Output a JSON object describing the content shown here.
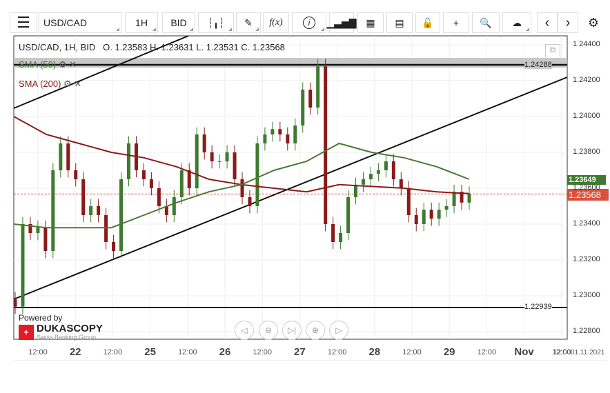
{
  "toolbar": {
    "instrument": "USD/CAD",
    "period": "1H",
    "side": "BID",
    "menu_icon": "hamburger-icon",
    "tools": [
      "candles-icon",
      "pencil-icon",
      "function-icon",
      "info-icon",
      "volume-bars-icon",
      "calendar-icon",
      "calculator-icon",
      "lock-icon",
      "crosshair-icon",
      "zoom-search-icon",
      "cloud-upload-icon",
      "chevron-left-icon",
      "chevron-right-icon",
      "gear-icon"
    ]
  },
  "header": {
    "title": "USD/CAD, 1H, BID",
    "ohlc": "O. 1.23583 H. 1.23631 L. 1.23531 C. 1.23568"
  },
  "indicators": [
    {
      "label": "SMA (50)",
      "color": "#4a7a33"
    },
    {
      "label": "SMA (200)",
      "color": "#8b1a1a"
    }
  ],
  "levels": {
    "upper": "1.24288",
    "lower": "1.22939"
  },
  "price_tags": {
    "sma50": "1.23649",
    "last": "1.23568"
  },
  "branding": {
    "powered": "Powered by",
    "logo": "DUKASCOPY",
    "tagline": "Swiss Banking Group"
  },
  "y_ticks": [
    "1.24400",
    "1.24200",
    "1.24000",
    "1.23800",
    "1.23600",
    "1.23400",
    "1.23200",
    "1.23000",
    "1.22800"
  ],
  "x_ticks": [
    {
      "t": "12:00",
      "day": false
    },
    {
      "t": "22",
      "day": true
    },
    {
      "t": "12:00",
      "day": false
    },
    {
      "t": "25",
      "day": true
    },
    {
      "t": "12:00",
      "day": false
    },
    {
      "t": "26",
      "day": true
    },
    {
      "t": "12:00",
      "day": false
    },
    {
      "t": "27",
      "day": true
    },
    {
      "t": "12:00",
      "day": false
    },
    {
      "t": "28",
      "day": true
    },
    {
      "t": "12:00",
      "day": false
    },
    {
      "t": "29",
      "day": true
    },
    {
      "t": "12:00",
      "day": false
    },
    {
      "t": "Nov",
      "day": true
    },
    {
      "t": "12:00",
      "day": false
    }
  ],
  "x_end_label": "01.11.2021",
  "chart_data": {
    "type": "candlestick",
    "ylim": [
      1.2275,
      1.2445
    ],
    "closes": [
      1.2294,
      1.234,
      1.2335,
      1.2338,
      1.2325,
      1.237,
      1.2385,
      1.237,
      1.2365,
      1.2345,
      1.235,
      1.2345,
      1.233,
      1.2325,
      1.2365,
      1.2385,
      1.237,
      1.2365,
      1.236,
      1.235,
      1.2345,
      1.2355,
      1.237,
      1.236,
      1.239,
      1.238,
      1.2375,
      1.2375,
      1.238,
      1.2365,
      1.2355,
      1.235,
      1.2385,
      1.239,
      1.2393,
      1.239,
      1.2385,
      1.2395,
      1.2415,
      1.2405,
      1.2428,
      1.234,
      1.233,
      1.2335,
      1.2355,
      1.2362,
      1.2365,
      1.2368,
      1.237,
      1.2375,
      1.2365,
      1.236,
      1.2345,
      1.234,
      1.2348,
      1.2343,
      1.2348,
      1.235,
      1.2358,
      1.2352,
      1.2357
    ],
    "sma50": [
      1.234,
      1.2338,
      1.2338,
      1.2338,
      1.2345,
      1.2352,
      1.2358,
      1.2362,
      1.237,
      1.2375,
      1.2385,
      1.238,
      1.2377,
      1.2372,
      1.2365
    ],
    "sma200": [
      1.24,
      1.239,
      1.2385,
      1.238,
      1.2377,
      1.2372,
      1.2365,
      1.2362,
      1.236,
      1.2358,
      1.2362,
      1.2361,
      1.236,
      1.2358,
      1.2357
    ]
  }
}
